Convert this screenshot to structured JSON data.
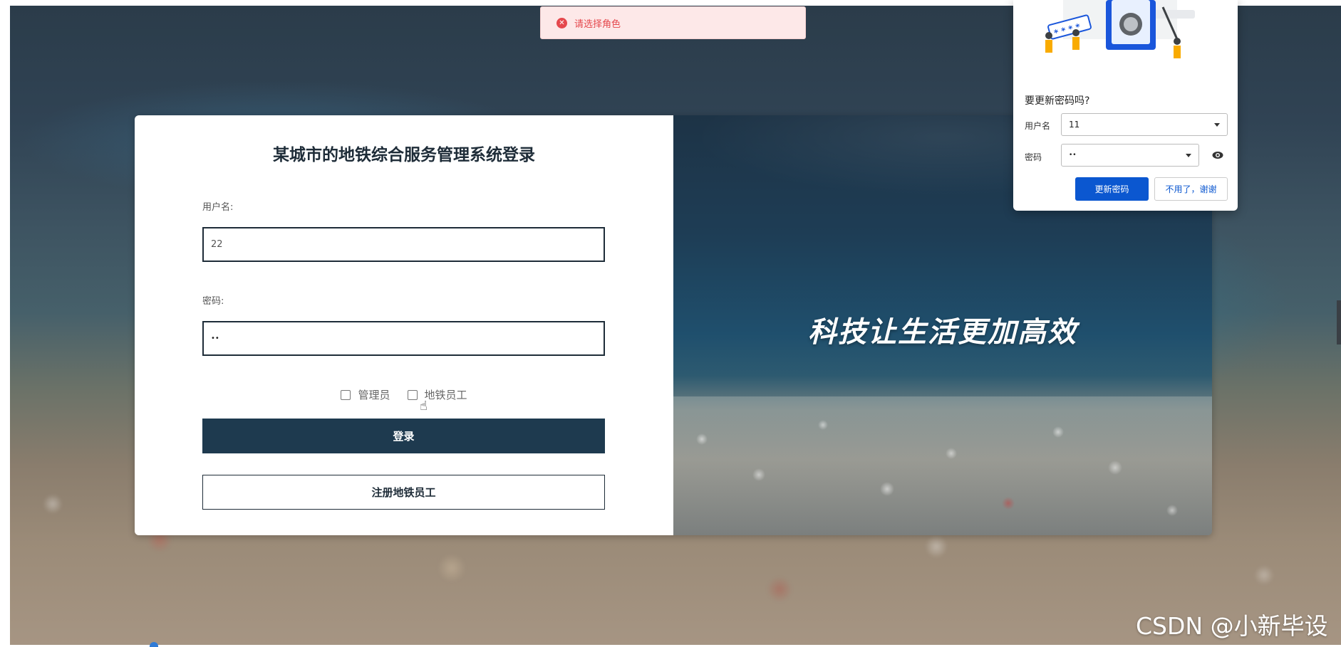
{
  "toast": {
    "icon": "error-circle-icon",
    "message": "请选择角色",
    "color": "#e5484d"
  },
  "login": {
    "title": "某城市的地铁综合服务管理系统登录",
    "username_label": "用户名:",
    "username_value": "22",
    "password_label": "密码:",
    "password_value": "••",
    "roles": [
      {
        "label": "管理员",
        "checked": false
      },
      {
        "label": "地铁员工",
        "checked": false
      }
    ],
    "login_button": "登录",
    "register_button": "注册地铁员工"
  },
  "banner": {
    "slogan": "科技让生活更加高效"
  },
  "password_popup": {
    "heading": "要更新密码吗?",
    "username_label": "用户名",
    "username_value": "11",
    "password_label": "密码",
    "password_value": "••",
    "update_button": "更新密码",
    "decline_button": "不用了，谢谢",
    "accent": "#0b57d0"
  },
  "watermark": "CSDN @小新毕设",
  "colors": {
    "primary": "#1e3a4f",
    "title": "#1e2c38"
  }
}
